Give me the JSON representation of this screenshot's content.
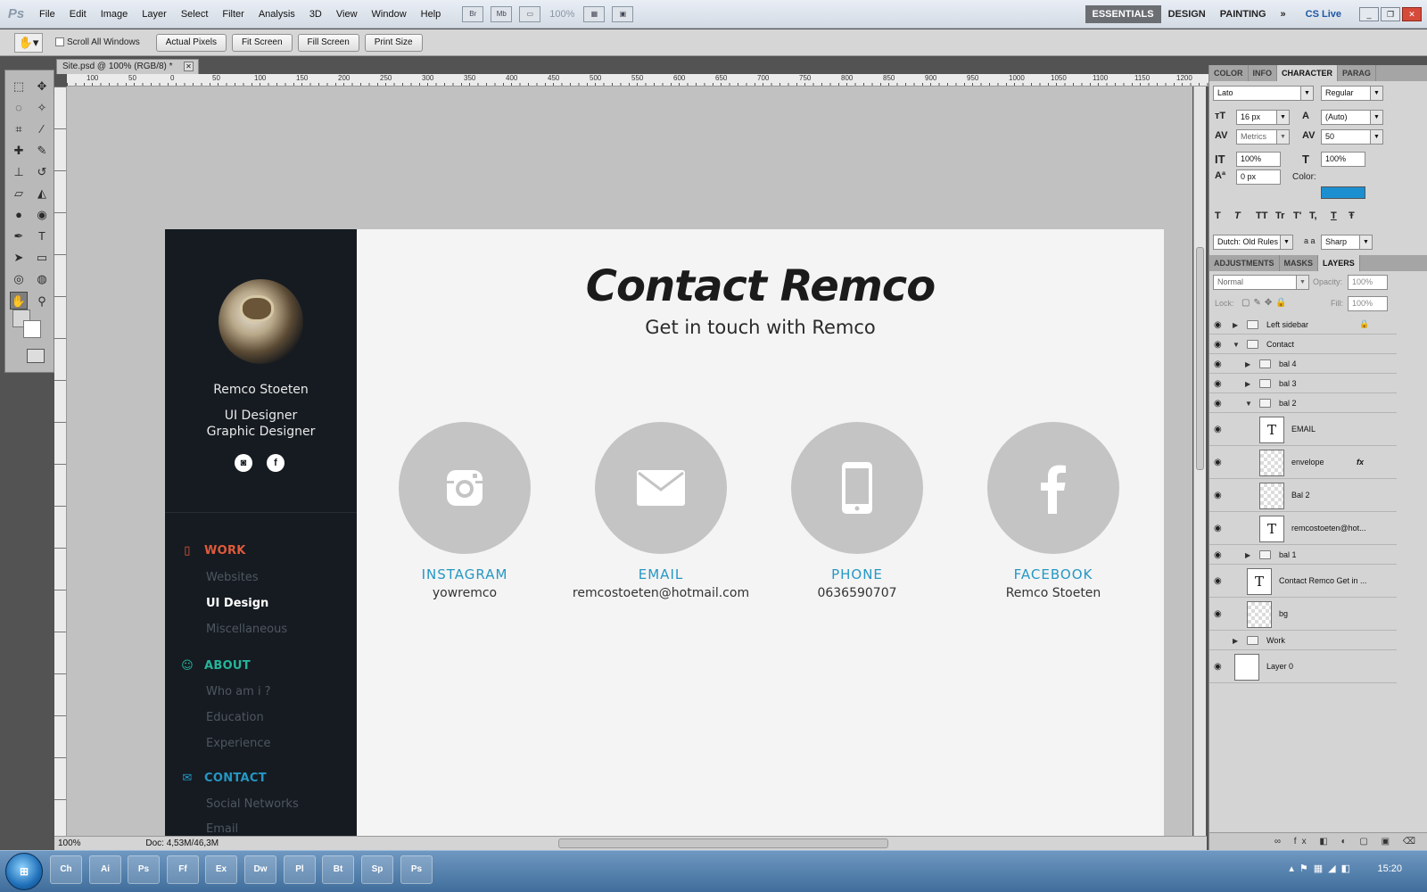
{
  "menubar": {
    "logo": "Ps",
    "items": [
      "File",
      "Edit",
      "Image",
      "Layer",
      "Select",
      "Filter",
      "Analysis",
      "3D",
      "View",
      "Window",
      "Help"
    ],
    "icons": [
      "Br",
      "Mb"
    ],
    "zoom": "100%",
    "workspaces": [
      "ESSENTIALS",
      "DESIGN",
      "PAINTING"
    ],
    "more": "»",
    "cslive": "CS Live"
  },
  "options": {
    "scroll_all_windows": "Scroll All Windows",
    "buttons": [
      "Actual Pixels",
      "Fit Screen",
      "Fill Screen",
      "Print Size"
    ]
  },
  "document": {
    "tab_title": "Site.psd @ 100% (RGB/8) *",
    "ruler_ticks": [
      "100",
      "50",
      "0",
      "50",
      "100",
      "150",
      "200",
      "250",
      "300",
      "350",
      "400",
      "450",
      "500",
      "550",
      "600",
      "650",
      "700",
      "750",
      "800",
      "850",
      "900",
      "950",
      "1000",
      "1050",
      "1100",
      "1150",
      "1200"
    ],
    "status": {
      "zoom": "100%",
      "doc": "Doc: 4,53M/46,3M"
    }
  },
  "site": {
    "sidebar": {
      "name": "Remco Stoeten",
      "role1": "UI Designer",
      "role2": "Graphic Designer",
      "nav": {
        "work": {
          "label": "WORK",
          "color": "#e05a3a",
          "items": [
            "Websites",
            "UI Design",
            "Miscellaneous"
          ]
        },
        "about": {
          "label": "ABOUT",
          "color": "#27b39a",
          "items": [
            "Who am i ?",
            "Education",
            "Experience"
          ]
        },
        "contact": {
          "label": "CONTACT",
          "color": "#2597c4",
          "items": [
            "Social Networks",
            "Email"
          ]
        }
      }
    },
    "title": "Contact Remco",
    "subtitle": "Get in touch with Remco",
    "cards": [
      {
        "label": "INSTAGRAM",
        "value": "yowremco",
        "icon": "instagram-icon"
      },
      {
        "label": "EMAIL",
        "value": "remcostoeten@hotmail.com",
        "icon": "envelope-icon"
      },
      {
        "label": "PHONE",
        "value": "0636590707",
        "icon": "phone-icon"
      },
      {
        "label": "FACEBOOK",
        "value": "Remco Stoeten",
        "icon": "facebook-icon"
      }
    ]
  },
  "character": {
    "tabs": [
      "COLOR",
      "INFO",
      "CHARACTER",
      "PARAG"
    ],
    "font": "Lato",
    "style": "Regular",
    "size": "16 px",
    "leading": "(Auto)",
    "kerning": "Metrics",
    "tracking": "50",
    "vscale": "100%",
    "hscale": "100%",
    "baseline": "0 px",
    "color_label": "Color:",
    "color": "#1c8fd0",
    "type_buttons": [
      "T",
      "T",
      "TT",
      "Tr",
      "T'",
      "T,",
      "T",
      "Ŧ"
    ],
    "language": "Dutch: Old Rules",
    "aa_label": "a a",
    "antialias": "Sharp"
  },
  "layers": {
    "tabs": [
      "ADJUSTMENTS",
      "MASKS",
      "LAYERS"
    ],
    "blend": "Normal",
    "opacity_label": "Opacity:",
    "opacity": "100%",
    "lock_label": "Lock:",
    "fill_label": "Fill:",
    "fill": "100%",
    "fx": "fx",
    "items": [
      {
        "name": "Left sidebar",
        "kind": "folder",
        "indent": 0
      },
      {
        "name": "Contact",
        "kind": "folder",
        "indent": 0
      },
      {
        "name": "bal 4",
        "kind": "folder",
        "indent": 1
      },
      {
        "name": "bal 3",
        "kind": "folder",
        "indent": 1
      },
      {
        "name": "bal 2",
        "kind": "folder",
        "indent": 1
      },
      {
        "name": "EMAIL",
        "kind": "text",
        "indent": 2
      },
      {
        "name": "envelope",
        "kind": "shape",
        "indent": 2
      },
      {
        "name": "Bal 2",
        "kind": "shape",
        "indent": 2
      },
      {
        "name": "remcostoeten@hot...",
        "kind": "text",
        "indent": 2
      },
      {
        "name": "bal 1",
        "kind": "folder",
        "indent": 1
      },
      {
        "name": "Contact Remco Get in ...",
        "kind": "text",
        "indent": 1
      },
      {
        "name": "bg",
        "kind": "shape",
        "indent": 1
      },
      {
        "name": "Work",
        "kind": "folder",
        "indent": 0
      },
      {
        "name": "Layer 0",
        "kind": "plain",
        "indent": 0
      }
    ]
  },
  "taskbar": {
    "start": "⊞",
    "apps": [
      "Ch",
      "Ai",
      "Ps",
      "Ff",
      "Ex",
      "Dw",
      "Pl",
      "Bt",
      "Sp",
      "Ps"
    ],
    "clock": "15:20"
  }
}
